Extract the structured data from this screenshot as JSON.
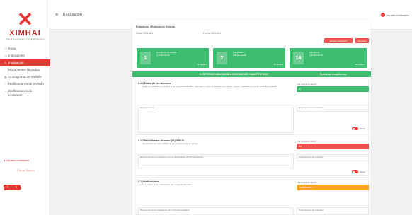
{
  "sidebar": {
    "logo": "XIMHAI",
    "logo_subtitle": "Sistema de Evaluación de Programas Educativos",
    "items": [
      {
        "icon": "home-icon",
        "label": "Inicio"
      },
      {
        "icon": "chart-icon",
        "label": "Indicadores"
      },
      {
        "icon": "list-icon",
        "label": "Evaluación",
        "active": true
      },
      {
        "icon": "doc-icon",
        "label": "Documentos liberados"
      },
      {
        "icon": "calendar-icon",
        "label": "Cronograma de revisión"
      },
      {
        "icon": "bell-icon",
        "label": "Notificaciones de revisión"
      },
      {
        "icon": "bell-icon",
        "label": "Notificaciones de evaluación"
      }
    ],
    "user": "Usuario evaluador",
    "logout": "Cerrar Sesión"
  },
  "topbar": {
    "page_title": "Evaluación",
    "user": "Usuario evaluador"
  },
  "main": {
    "breadcrumb": "Evaluación / Evaluación Externa",
    "meta_left": "Clave: 2021-001",
    "meta_right": "Fecha: 2021-001",
    "btn_eval": "Estado evaluación",
    "btn_view": "Regresar",
    "stats": [
      {
        "num": "1",
        "label1": "Indicadores de calidad",
        "label2": "Cumple parcial",
        "foot": "Ver detalles"
      },
      {
        "num": "7",
        "label1": "Indicadores",
        "label2": "Cumple parcial",
        "foot": "Ver detalles"
      },
      {
        "num": "14",
        "label1": "Indicadores",
        "label2": "Cumple parcial",
        "foot": "Ver detalles"
      }
    ],
    "section_title": "2. CRITERIOS ASOCIADOS A INDICADORES CUANTITATIVOS",
    "section_right": "Estado de cumplimiento",
    "items": [
      {
        "title": "2.1.1 Datos de los alumnos",
        "desc": "Datos de los alumnos inscritos en el programa educativo. Información sobre la situación de ingreso, egreso y titulación de los alumnos del programa.",
        "note": "Observaciones:",
        "q_label": "¿Se cumple el criterio?",
        "q_value": "Sí",
        "q_color": "#3dbd6f",
        "right_note": "Observaciones del evaluador",
        "toggle": "Activo"
      },
      {
        "title": "2.1.2 Identificador de autor (ID) ORCID",
        "desc": "Identificador de autor ORCID de los profesores del programa.",
        "note": "Documento de los profesores con su identificador ORCID actualizado.",
        "q_label": "¿Se cumple el criterio?",
        "q_value": "No",
        "q_color": "#ef5350",
        "right_note": "Observaciones del evaluador",
        "toggle": "Activo"
      },
      {
        "title": "2.1.3 Indicadores",
        "desc": "Información de los indicadores del programa educativo.",
        "note": "Documento de los indicadores del programa educativo.",
        "q_label": "¿Se cumple el criterio?",
        "q_value": "Parcialmente",
        "q_color": "#f5a623",
        "right_note": "Observaciones del evaluador",
        "toggle": "Activo"
      }
    ]
  }
}
